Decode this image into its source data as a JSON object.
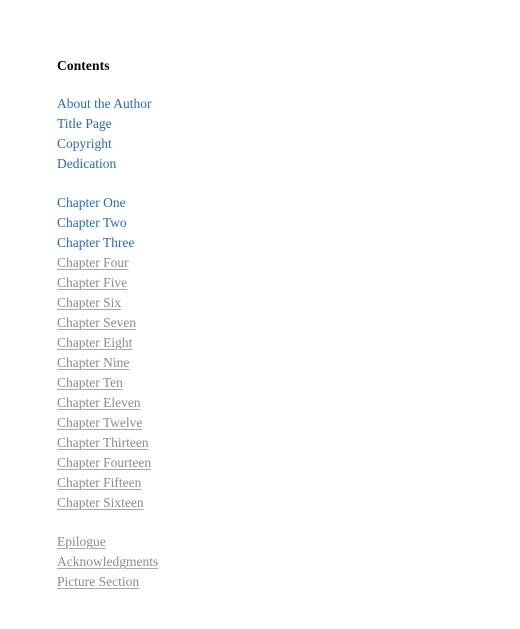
{
  "page": {
    "heading": "Contents",
    "background_color": "#ffffff",
    "heading_color": "#000000",
    "link_active_color": "#2a6cb0",
    "link_muted_color": "#8d8d8d"
  },
  "groups": [
    {
      "name": "front-matter",
      "entries": [
        {
          "label": "About the Author",
          "style": "active"
        },
        {
          "label": "Title Page",
          "style": "active"
        },
        {
          "label": "Copyright",
          "style": "active"
        },
        {
          "label": "Dedication",
          "style": "active"
        }
      ]
    },
    {
      "name": "chapters",
      "entries": [
        {
          "label": "Chapter One",
          "style": "active"
        },
        {
          "label": "Chapter Two",
          "style": "active"
        },
        {
          "label": "Chapter Three",
          "style": "active"
        },
        {
          "label": "Chapter Four",
          "style": "muted"
        },
        {
          "label": "Chapter Five",
          "style": "muted"
        },
        {
          "label": "Chapter Six",
          "style": "muted"
        },
        {
          "label": "Chapter Seven",
          "style": "muted"
        },
        {
          "label": "Chapter Eight",
          "style": "muted"
        },
        {
          "label": "Chapter Nine",
          "style": "muted"
        },
        {
          "label": "Chapter Ten",
          "style": "muted"
        },
        {
          "label": "Chapter Eleven",
          "style": "muted"
        },
        {
          "label": "Chapter Twelve",
          "style": "muted"
        },
        {
          "label": "Chapter Thirteen",
          "style": "muted"
        },
        {
          "label": "Chapter Fourteen",
          "style": "muted"
        },
        {
          "label": "Chapter Fifteen",
          "style": "muted"
        },
        {
          "label": "Chapter Sixteen",
          "style": "muted"
        }
      ]
    },
    {
      "name": "back-matter",
      "entries": [
        {
          "label": "Epilogue",
          "style": "muted"
        },
        {
          "label": "Acknowledgments",
          "style": "muted"
        },
        {
          "label": "Picture Section",
          "style": "muted"
        }
      ]
    }
  ]
}
